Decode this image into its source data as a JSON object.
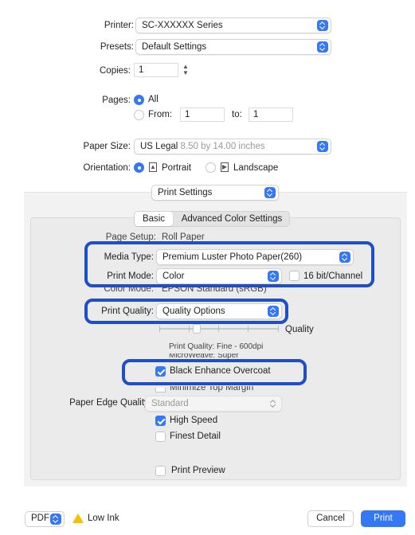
{
  "printer": {
    "label": "Printer:",
    "value": "SC-XXXXXX Series"
  },
  "presets": {
    "label": "Presets:",
    "value": "Default Settings"
  },
  "copies": {
    "label": "Copies:",
    "value": "1"
  },
  "pages": {
    "label": "Pages:",
    "all_label": "All",
    "from_label": "From:",
    "from_value": "1",
    "to_label": "to:",
    "to_value": "1"
  },
  "paper_size": {
    "label": "Paper Size:",
    "value": "US Legal",
    "dims": "8.50 by 14.00 inches"
  },
  "orientation": {
    "label": "Orientation:",
    "portrait": "Portrait",
    "landscape": "Landscape"
  },
  "section_popup": "Print Settings",
  "tabs": {
    "basic": "Basic",
    "advanced": "Advanced Color Settings"
  },
  "page_setup": {
    "label": "Page Setup:",
    "value": "Roll Paper"
  },
  "media_type": {
    "label": "Media Type:",
    "value": "Premium Luster Photo Paper(260)"
  },
  "print_mode": {
    "label": "Print Mode:",
    "value": "Color",
    "bit_label": "16 bit/Channel"
  },
  "color_mode": {
    "label": "Color Mode:",
    "value": "EPSON Standard (sRGB)"
  },
  "print_quality": {
    "label": "Print Quality:",
    "value": "Quality Options",
    "slider_label": "Quality",
    "slider_level": 0.3,
    "info1": "Print Quality: Fine - 600dpi",
    "info2": "MicroWeave: Super"
  },
  "black_enhance": "Black Enhance Overcoat",
  "minimize_top": "Minimize Top Margin",
  "paper_edge": {
    "label": "Paper Edge Quality:",
    "value": "Standard"
  },
  "high_speed": "High Speed",
  "finest_detail": "Finest Detail",
  "print_preview": "Print Preview",
  "footer": {
    "pdf": "PDF",
    "low_ink": "Low Ink",
    "cancel": "Cancel",
    "print": "Print"
  },
  "colors": {
    "accent": "#3478f6",
    "highlight": "#1e4fc8",
    "panel": "#f2f2f2"
  }
}
